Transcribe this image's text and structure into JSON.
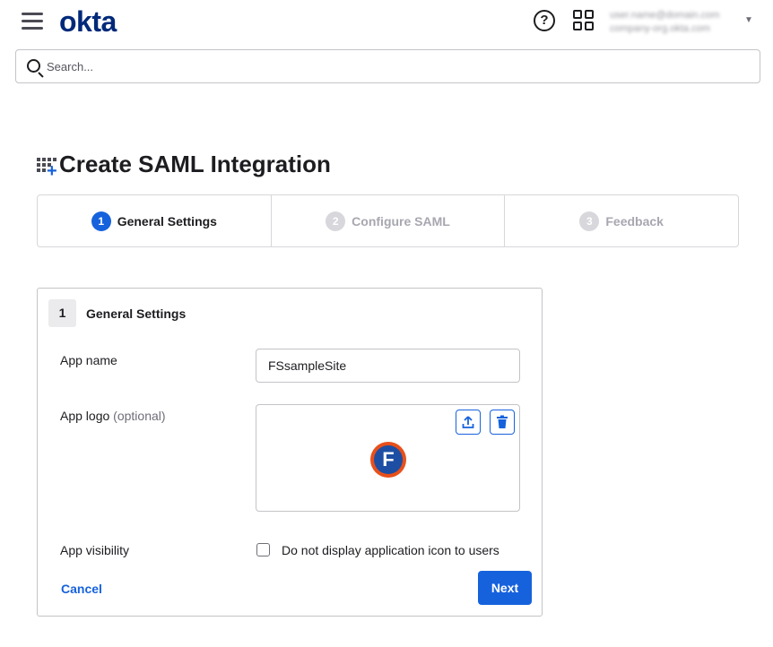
{
  "header": {
    "logo_text": "okta",
    "help_glyph": "?",
    "user_line_1": "user.name@domain.com",
    "user_line_2": "company-org.okta.com"
  },
  "search": {
    "placeholder": "Search..."
  },
  "page": {
    "title": "Create SAML Integration"
  },
  "steps": [
    {
      "number": "1",
      "label": "General Settings",
      "state": "active"
    },
    {
      "number": "2",
      "label": "Configure SAML",
      "state": "inactive"
    },
    {
      "number": "3",
      "label": "Feedback",
      "state": "inactive"
    }
  ],
  "card": {
    "number": "1",
    "title": "General Settings",
    "app_name_label": "App name",
    "app_name_value": "FSsampleSite",
    "app_logo_label": "App logo",
    "app_logo_optional": "(optional)",
    "app_logo_letter": "F",
    "app_visibility_label": "App visibility",
    "visibility_checkbox_label": "Do not display application icon to users",
    "visibility_checked": false,
    "cancel_label": "Cancel",
    "next_label": "Next"
  },
  "colors": {
    "brand": "#00297a",
    "accent": "#1662dd",
    "inactive_step": "#a7a7b0",
    "logo_ring": "#e8501b"
  },
  "icons": [
    "hamburger-menu-icon",
    "help-icon",
    "apps-grid-icon",
    "chevron-down-icon",
    "search-icon",
    "add-app-icon",
    "upload-icon",
    "trash-icon"
  ]
}
